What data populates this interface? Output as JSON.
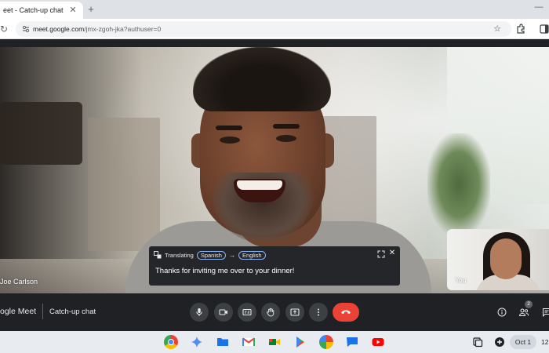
{
  "browser": {
    "tab_title": "eet - Catch-up chat",
    "url_host": "meet.google.com",
    "url_path": "/jmx-zgoh-jka?authuser=0"
  },
  "meet": {
    "participant_name": "Joe Carlson",
    "self_label": "You",
    "caption": {
      "status": "Translating",
      "from_language": "Spanish",
      "to_language": "English",
      "text": "Thanks for inviting me over to your dinner!"
    },
    "brand": "ogle Meet",
    "meeting_title": "Catch-up chat",
    "people_count": "2",
    "end_call_color": "#ea4335"
  },
  "shelf": {
    "apps": [
      "chrome-icon",
      "gemini-icon",
      "files-icon",
      "gmail-icon",
      "meet-icon",
      "play-store-icon",
      "photos-icon",
      "messages-icon",
      "youtube-icon"
    ],
    "date": "Oct 1",
    "time": "12"
  }
}
